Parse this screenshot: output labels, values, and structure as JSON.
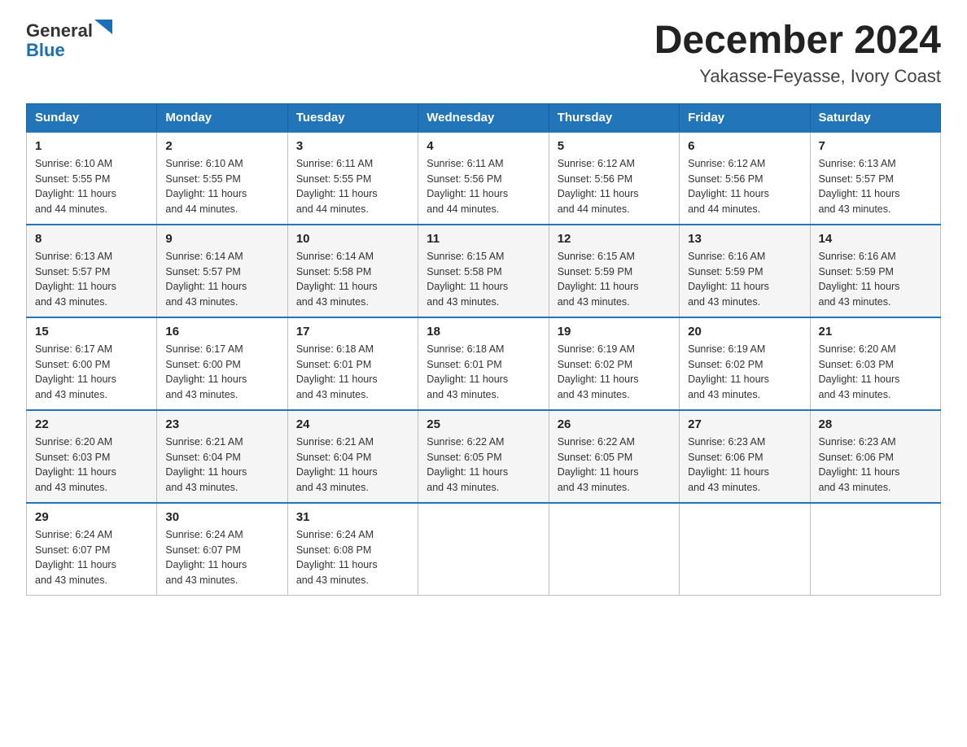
{
  "logo": {
    "general": "General",
    "blue": "Blue"
  },
  "title": {
    "month": "December 2024",
    "location": "Yakasse-Feyasse, Ivory Coast"
  },
  "weekdays": [
    "Sunday",
    "Monday",
    "Tuesday",
    "Wednesday",
    "Thursday",
    "Friday",
    "Saturday"
  ],
  "weeks": [
    [
      {
        "day": "1",
        "sunrise": "6:10 AM",
        "sunset": "5:55 PM",
        "daylight": "11 hours and 44 minutes."
      },
      {
        "day": "2",
        "sunrise": "6:10 AM",
        "sunset": "5:55 PM",
        "daylight": "11 hours and 44 minutes."
      },
      {
        "day": "3",
        "sunrise": "6:11 AM",
        "sunset": "5:55 PM",
        "daylight": "11 hours and 44 minutes."
      },
      {
        "day": "4",
        "sunrise": "6:11 AM",
        "sunset": "5:56 PM",
        "daylight": "11 hours and 44 minutes."
      },
      {
        "day": "5",
        "sunrise": "6:12 AM",
        "sunset": "5:56 PM",
        "daylight": "11 hours and 44 minutes."
      },
      {
        "day": "6",
        "sunrise": "6:12 AM",
        "sunset": "5:56 PM",
        "daylight": "11 hours and 44 minutes."
      },
      {
        "day": "7",
        "sunrise": "6:13 AM",
        "sunset": "5:57 PM",
        "daylight": "11 hours and 43 minutes."
      }
    ],
    [
      {
        "day": "8",
        "sunrise": "6:13 AM",
        "sunset": "5:57 PM",
        "daylight": "11 hours and 43 minutes."
      },
      {
        "day": "9",
        "sunrise": "6:14 AM",
        "sunset": "5:57 PM",
        "daylight": "11 hours and 43 minutes."
      },
      {
        "day": "10",
        "sunrise": "6:14 AM",
        "sunset": "5:58 PM",
        "daylight": "11 hours and 43 minutes."
      },
      {
        "day": "11",
        "sunrise": "6:15 AM",
        "sunset": "5:58 PM",
        "daylight": "11 hours and 43 minutes."
      },
      {
        "day": "12",
        "sunrise": "6:15 AM",
        "sunset": "5:59 PM",
        "daylight": "11 hours and 43 minutes."
      },
      {
        "day": "13",
        "sunrise": "6:16 AM",
        "sunset": "5:59 PM",
        "daylight": "11 hours and 43 minutes."
      },
      {
        "day": "14",
        "sunrise": "6:16 AM",
        "sunset": "5:59 PM",
        "daylight": "11 hours and 43 minutes."
      }
    ],
    [
      {
        "day": "15",
        "sunrise": "6:17 AM",
        "sunset": "6:00 PM",
        "daylight": "11 hours and 43 minutes."
      },
      {
        "day": "16",
        "sunrise": "6:17 AM",
        "sunset": "6:00 PM",
        "daylight": "11 hours and 43 minutes."
      },
      {
        "day": "17",
        "sunrise": "6:18 AM",
        "sunset": "6:01 PM",
        "daylight": "11 hours and 43 minutes."
      },
      {
        "day": "18",
        "sunrise": "6:18 AM",
        "sunset": "6:01 PM",
        "daylight": "11 hours and 43 minutes."
      },
      {
        "day": "19",
        "sunrise": "6:19 AM",
        "sunset": "6:02 PM",
        "daylight": "11 hours and 43 minutes."
      },
      {
        "day": "20",
        "sunrise": "6:19 AM",
        "sunset": "6:02 PM",
        "daylight": "11 hours and 43 minutes."
      },
      {
        "day": "21",
        "sunrise": "6:20 AM",
        "sunset": "6:03 PM",
        "daylight": "11 hours and 43 minutes."
      }
    ],
    [
      {
        "day": "22",
        "sunrise": "6:20 AM",
        "sunset": "6:03 PM",
        "daylight": "11 hours and 43 minutes."
      },
      {
        "day": "23",
        "sunrise": "6:21 AM",
        "sunset": "6:04 PM",
        "daylight": "11 hours and 43 minutes."
      },
      {
        "day": "24",
        "sunrise": "6:21 AM",
        "sunset": "6:04 PM",
        "daylight": "11 hours and 43 minutes."
      },
      {
        "day": "25",
        "sunrise": "6:22 AM",
        "sunset": "6:05 PM",
        "daylight": "11 hours and 43 minutes."
      },
      {
        "day": "26",
        "sunrise": "6:22 AM",
        "sunset": "6:05 PM",
        "daylight": "11 hours and 43 minutes."
      },
      {
        "day": "27",
        "sunrise": "6:23 AM",
        "sunset": "6:06 PM",
        "daylight": "11 hours and 43 minutes."
      },
      {
        "day": "28",
        "sunrise": "6:23 AM",
        "sunset": "6:06 PM",
        "daylight": "11 hours and 43 minutes."
      }
    ],
    [
      {
        "day": "29",
        "sunrise": "6:24 AM",
        "sunset": "6:07 PM",
        "daylight": "11 hours and 43 minutes."
      },
      {
        "day": "30",
        "sunrise": "6:24 AM",
        "sunset": "6:07 PM",
        "daylight": "11 hours and 43 minutes."
      },
      {
        "day": "31",
        "sunrise": "6:24 AM",
        "sunset": "6:08 PM",
        "daylight": "11 hours and 43 minutes."
      },
      null,
      null,
      null,
      null
    ]
  ],
  "labels": {
    "sunrise": "Sunrise:",
    "sunset": "Sunset:",
    "daylight": "Daylight:"
  }
}
